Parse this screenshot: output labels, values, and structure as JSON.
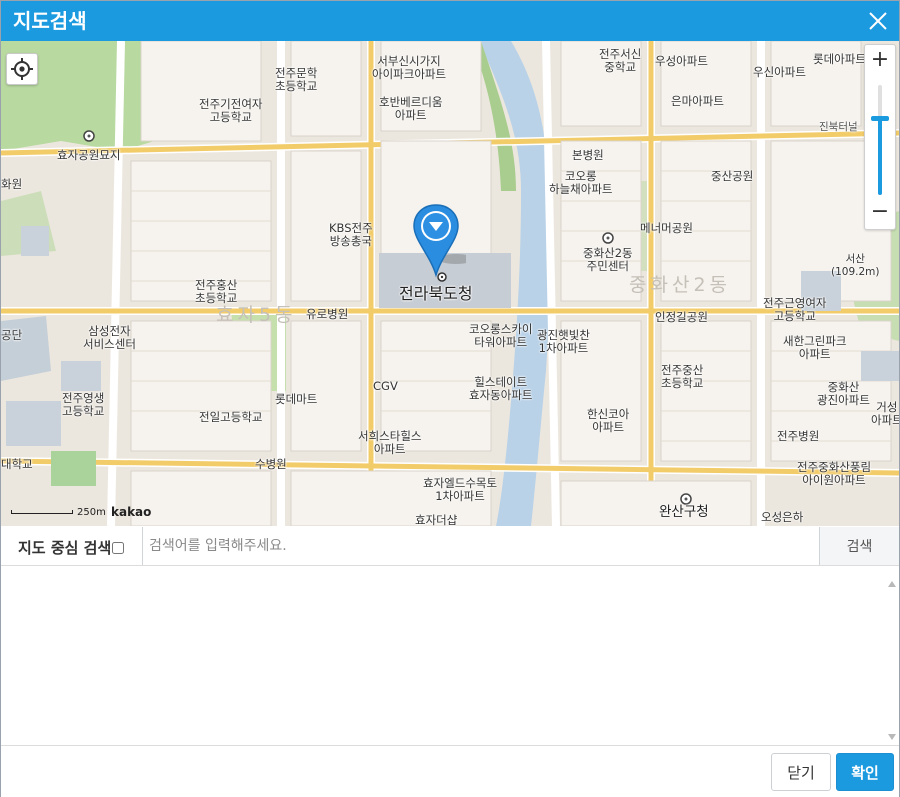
{
  "dialog": {
    "title": "지도검색",
    "close_icon": "close-icon",
    "accent": "#1b9ae0"
  },
  "map": {
    "provider": "kakao",
    "scale_label": "250m",
    "marker_label": "전라북도청",
    "labels": {
      "l1": "서부신시가지\n아이파크아파트",
      "l2": "전주서신\n중학교",
      "l3": "우성아파트",
      "l4": "우신아파트",
      "l5": "롯데아파트",
      "l6": "전주문학\n초등학교",
      "l7": "호반베르디움\n아파트",
      "l8": "은마아파트",
      "l9": "전주기전여자\n고등학교",
      "l10": "효자공원묘지",
      "l11": "화원",
      "l12": "본병원",
      "l13": "진북터널",
      "l14": "코오롱\n하늘채아파트",
      "l15": "중산공원",
      "l16": "KBS전주\n방송총국",
      "l17": "메너머공원",
      "l18": "서산\n(109.2m)",
      "l19": "중화산2동\n주민센터",
      "l20": "전주홍산\n초등학교",
      "l21": "중화산2동",
      "l22": "전주근영여자\n고등학교",
      "l23": "효자5동",
      "l24": "유로병원",
      "l25": "인정길공원",
      "l26": "공단",
      "l27": "삼성전자\n서비스센터",
      "l28": "코오롱스카이\n타워아파트",
      "l29": "광진햇빛찬\n1차아파트",
      "l30": "새한그린파크\n아파트",
      "l31": "CGV",
      "l32": "전주중산\n초등학교",
      "l33": "전주영생\n고등학교",
      "l34": "롯데마트",
      "l35": "힐스테이트\n효자동아파트",
      "l36": "중화산\n광진아파트",
      "l37": "전일고등학교",
      "l38": "한신코아\n아파트",
      "l39": "거성\n아파트",
      "l40": "서희스타힐스\n아파트",
      "l41": "전주병원",
      "l42": "대학교",
      "l43": "수병원",
      "l44": "전주중화산풍림\n아이원아파트",
      "l45": "효자엘드수목토\n1차아파트",
      "l46": "완산구청",
      "l47": "효자더샵",
      "l48": "오성은하"
    }
  },
  "search": {
    "label": "지도 중심 검색",
    "placeholder": "검색어를 입력해주세요.",
    "value": "",
    "button_label": "검색",
    "checkbox_checked": false
  },
  "footer": {
    "close_label": "닫기",
    "confirm_label": "확인"
  },
  "zoom": {
    "in_label": "+",
    "out_label": "−",
    "level": 0.7
  }
}
